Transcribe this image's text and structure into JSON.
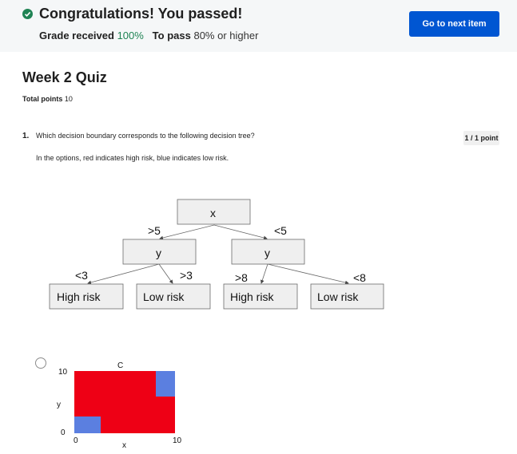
{
  "banner": {
    "headline": "Congratulations! You passed!",
    "grade_label": "Grade received",
    "grade_value": "100%",
    "pass_label": "To pass",
    "pass_value": "80% or higher",
    "next_button": "Go to next item",
    "icon": "check-circle-icon"
  },
  "quiz": {
    "title": "Week 2 Quiz",
    "total_label": "Total points",
    "total_value": "10"
  },
  "question": {
    "number": "1.",
    "text": "Which decision boundary corresponds to the following decision tree?",
    "note": "In the options, red indicates high risk, blue indicates low risk.",
    "points": "1 / 1 point"
  },
  "tree": {
    "root": "x",
    "left_node": "y",
    "right_node": "y",
    "edge_root_left": ">5",
    "edge_root_right": "<5",
    "edge_ll": "<3",
    "edge_lr": ">3",
    "edge_rl": ">8",
    "edge_rr": "<8",
    "leaf_1": "High risk",
    "leaf_2": "Low risk",
    "leaf_3": "High risk",
    "leaf_4": "Low risk"
  },
  "option_a": {
    "label": "C",
    "y_axis": "y",
    "x_axis": "x",
    "y_top": "10",
    "y_bottom": "0",
    "x_left": "0",
    "x_right": "10",
    "colors": {
      "high": "#ee0015",
      "low": "#5b7fe0"
    }
  }
}
